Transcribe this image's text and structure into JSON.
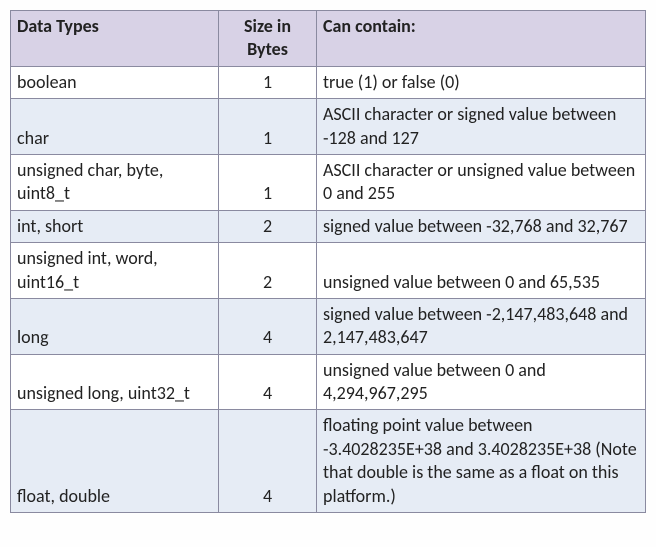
{
  "headers": {
    "types": "Data Types",
    "size": "Size in Bytes",
    "desc": "Can contain:"
  },
  "rows": [
    {
      "type": "boolean",
      "size": "1",
      "desc": "true (1) or false (0)"
    },
    {
      "type": "char",
      "size": "1",
      "desc": "ASCII character or signed value between -128 and 127"
    },
    {
      "type": "unsigned char, byte, uint8_t",
      "size": "1",
      "desc": "ASCII character or unsigned value between 0 and 255"
    },
    {
      "type": "int, short",
      "size": "2",
      "desc": "signed value between -32,768 and 32,767"
    },
    {
      "type": "unsigned int, word, uint16_t",
      "size": "2",
      "desc": "unsigned value between 0 and 65,535"
    },
    {
      "type": "long",
      "size": "4",
      "desc": "signed value between -2,147,483,648 and 2,147,483,647"
    },
    {
      "type": "unsigned long, uint32_t",
      "size": "4",
      "desc": "unsigned value between 0 and 4,294,967,295"
    },
    {
      "type": "float, double",
      "size": "4",
      "desc": "floating point value between -3.4028235E+38 and 3.4028235E+38 (Note that double is the same as a float on this platform.)"
    }
  ]
}
